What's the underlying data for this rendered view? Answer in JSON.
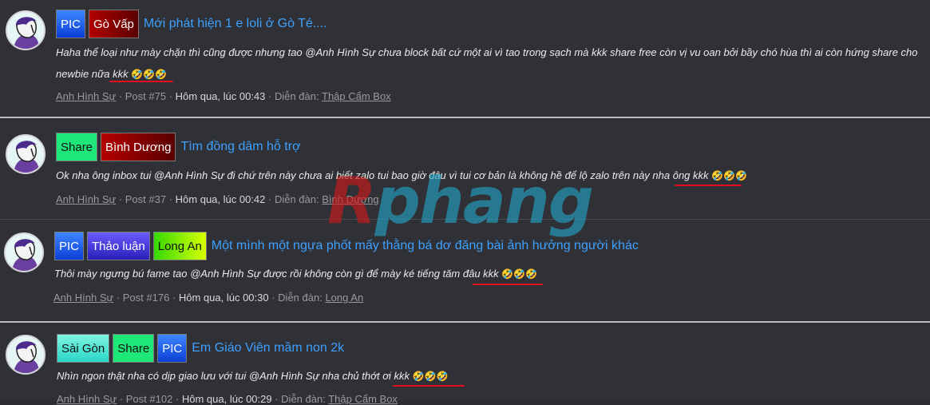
{
  "posts": [
    {
      "tags": [
        {
          "label": "PIC",
          "style": "blue"
        },
        {
          "label": "Gò Vấp",
          "style": "red"
        }
      ],
      "title": "Mới phát hiện 1 e loli ở Gò Té....",
      "snippet_line1": "Haha thể loại như mày chặn thì cũng được nhưng tao @Anh Hình Sự chưa block bất cứ một ai vì tao trong sạch mà kkk share free còn vị vu oan bởi bầy chó hùa thì ai còn hứng share cho",
      "snippet_line2": "newbie nữa kkk",
      "emoji": "🤣🤣🤣",
      "author": "Anh Hình Sự",
      "post_no": "Post #75",
      "time": "Hôm qua, lúc 00:43",
      "forum_label": "Diễn đàn:",
      "forum": "Thập Cẩm Box"
    },
    {
      "tags": [
        {
          "label": "Share",
          "style": "green"
        },
        {
          "label": "Bình Dương",
          "style": "red"
        }
      ],
      "title": "Tìm đồng dâm hỗ trợ",
      "snippet_line1": "Ok nha ông inbox tui @Anh Hình Sự đi chứ trên này chưa ai biết zalo tui bao giờ đâu vì tui cơ bản là không hề để lộ zalo trên này nha ông kkk",
      "emoji": "🤣🤣🤣",
      "author": "Anh Hình Sự",
      "post_no": "Post #37",
      "time": "Hôm qua, lúc 00:42",
      "forum_label": "Diễn đàn:",
      "forum": "Bình Dương"
    },
    {
      "tags": [
        {
          "label": "PIC",
          "style": "blue"
        },
        {
          "label": "Thảo luận",
          "style": "purple"
        },
        {
          "label": "Long An",
          "style": "lime"
        }
      ],
      "title": "Một mình một ngựa phốt mấy thằng bá dơ đăng bài ảnh hưởng người khác",
      "snippet_line1": "Thôi mày ngưng bú fame tao @Anh Hình Sự được rồi không còn gì để mày ké tiếng tăm đâu kkk",
      "emoji": "🤣🤣🤣",
      "author": "Anh Hình Sự",
      "post_no": "Post #176",
      "time": "Hôm qua, lúc 00:30",
      "forum_label": "Diễn đàn:",
      "forum": "Long An"
    },
    {
      "tags": [
        {
          "label": "Sài Gòn",
          "style": "cyan"
        },
        {
          "label": "Share",
          "style": "green"
        },
        {
          "label": "PIC",
          "style": "blue"
        }
      ],
      "title": "Em Giáo Viên mầm non 2k",
      "snippet_line1": "Nhìn ngon thật nha có dịp giao lưu với tui @Anh Hình Sự nha chủ thớt ơi kkk",
      "emoji": "🤣🤣🤣",
      "author": "Anh Hình Sự",
      "post_no": "Post #102",
      "time": "Hôm qua, lúc 00:29",
      "forum_label": "Diễn đàn:",
      "forum": "Thập Cẩm Box"
    }
  ],
  "watermark": {
    "part1": "R",
    "part2": "phang",
    "accent_red": "#d2191b",
    "accent_blue": "#22a6c8"
  },
  "colors": {
    "background": "#2f3136",
    "link": "#3ea0ff",
    "underline": "#e0101f"
  }
}
